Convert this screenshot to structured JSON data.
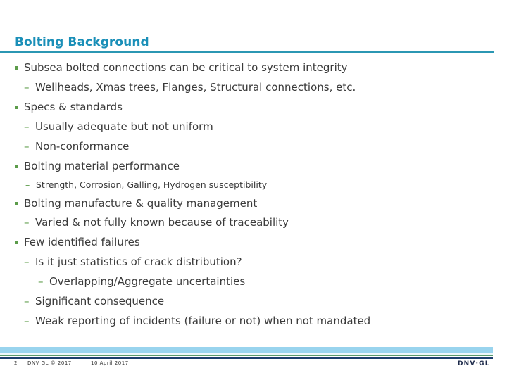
{
  "slide": {
    "title": "Bolting Background",
    "bullets": [
      {
        "level": 1,
        "text": "Subsea bolted connections can be critical to system integrity"
      },
      {
        "level": 2,
        "text": "Wellheads, Xmas trees, Flanges, Structural connections, etc."
      },
      {
        "level": 1,
        "text": "Specs & standards"
      },
      {
        "level": 2,
        "text": "Usually adequate but not uniform"
      },
      {
        "level": 2,
        "text": "Non-conformance"
      },
      {
        "level": 1,
        "text": "Bolting material performance"
      },
      {
        "level": 2,
        "text": "Strength, Corrosion, Galling, Hydrogen susceptibility"
      },
      {
        "level": 1,
        "text": "Bolting manufacture & quality management"
      },
      {
        "level": 2,
        "text": "Varied & not fully known because of traceability"
      },
      {
        "level": 1,
        "text": "Few identified failures"
      },
      {
        "level": 2,
        "text": "Is it just statistics of crack distribution?"
      },
      {
        "level": 3,
        "text": "Overlapping/Aggregate uncertainties"
      },
      {
        "level": 2,
        "text": "Significant consequence"
      },
      {
        "level": 2,
        "text": "Weak reporting of incidents (failure or not) when not mandated"
      }
    ],
    "dash_glyph": "–"
  },
  "footer": {
    "page_number": "2",
    "copyright": "DNV GL © 2017",
    "date": "10 April 2017",
    "logo_text": "DNV·GL"
  },
  "colors": {
    "title": "#1a8fb8",
    "accent_green": "#5c9c4a",
    "rule": "#2b97b3",
    "footer_light_blue": "#99d4ee",
    "footer_navy": "#1d3f6e"
  }
}
